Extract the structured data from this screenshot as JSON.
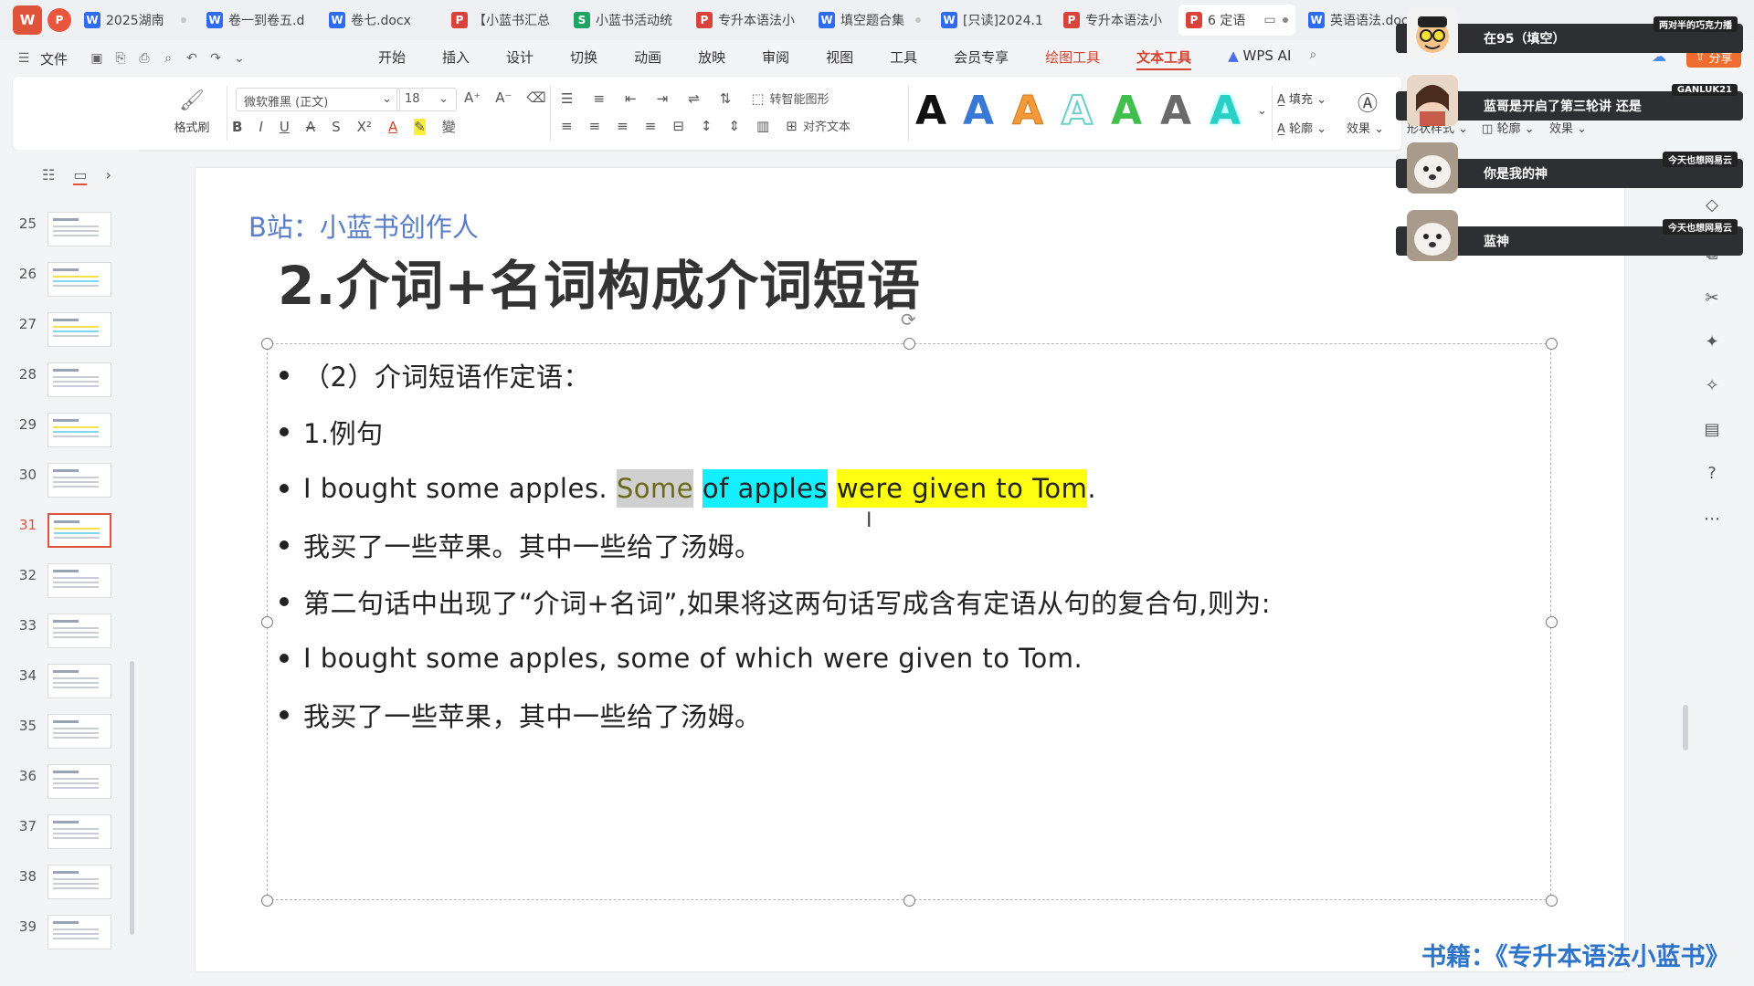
{
  "tabs": [
    {
      "kind": "w",
      "title": "2025湖南"
    },
    {
      "kind": "w",
      "title": "卷一到卷五.d"
    },
    {
      "kind": "w",
      "title": "卷七.docx"
    },
    {
      "kind": "p",
      "title": "【小蓝书汇总"
    },
    {
      "kind": "s",
      "title": "小蓝书活动统"
    },
    {
      "kind": "p",
      "title": "专升本语法小"
    },
    {
      "kind": "w",
      "title": "填空题合集"
    },
    {
      "kind": "w",
      "title": "[只读]2024.1"
    },
    {
      "kind": "p",
      "title": "专升本语法小"
    },
    {
      "kind": "p",
      "title": "6 定语"
    },
    {
      "kind": "w",
      "title": "英语语法.doc"
    }
  ],
  "menu": {
    "file": "文件",
    "items": [
      "开始",
      "插入",
      "设计",
      "切换",
      "动画",
      "放映",
      "审阅",
      "视图",
      "工具",
      "会员专享",
      "绘图工具",
      "文本工具"
    ],
    "wps_ai": "WPS AI",
    "share": "分享"
  },
  "ribbon": {
    "format_painter": "格式刷",
    "font_name": "微软雅黑 (正文)",
    "font_size": "18",
    "smart_shape": "转智能图形",
    "align_text": "对齐文本",
    "fill": "填充",
    "outline": "轮廓",
    "effect": "效果",
    "shape_style": "形状样式",
    "shape_outline": "轮廓",
    "shape_effect": "效果",
    "style_colors": [
      "#111111",
      "#3a78d6",
      "#f29a3a",
      "#69d0cc",
      "#3fbf4c",
      "#6a6a6a",
      "#2ad0c6"
    ]
  },
  "slides": {
    "numbers": [
      25,
      26,
      27,
      28,
      29,
      30,
      31,
      32,
      33,
      34,
      35,
      36,
      37,
      38,
      39
    ],
    "active": 31
  },
  "slide": {
    "brand": "B站：小蓝书创作人",
    "title": "2.介词+名词构成介词短语",
    "lines": {
      "l1": "（2）介词短语作定语：",
      "l2": "1.例句",
      "l3_pre": "I bought some apples. ",
      "l3_gray": "Some",
      "l3_cyan": "of apples",
      "l3_yellow": "were given to Tom",
      "l3_end": ".",
      "l4": "我买了一些苹果。其中一些给了汤姆。",
      "l5": "第二句话中出现了“介词+名词”,如果将这两句话写成含有定语从句的复合句,则为:",
      "l6": "I bought some apples, some of which were given to Tom.",
      "l7": "我买了一些苹果，其中一些给了汤姆。"
    },
    "footer": "书籍：《专升本语法小蓝书》"
  },
  "chat": [
    {
      "badge": "两对半的巧克力播",
      "text": "在95（填空）"
    },
    {
      "badge": "GANLUK21",
      "text": "蓝哥是开启了第三轮讲 还是"
    },
    {
      "badge": "今天也想网易云",
      "text": "你是我的神"
    },
    {
      "badge": "今天也想网易云",
      "text": "蓝神"
    }
  ],
  "colors": {
    "accent": "#d0442f",
    "brand_blue": "#5a7ec7",
    "footer_blue": "#2e74c9",
    "highlight_gray": "#d0d0d0",
    "highlight_cyan": "#14f0ff",
    "highlight_yellow": "#ffff11"
  }
}
